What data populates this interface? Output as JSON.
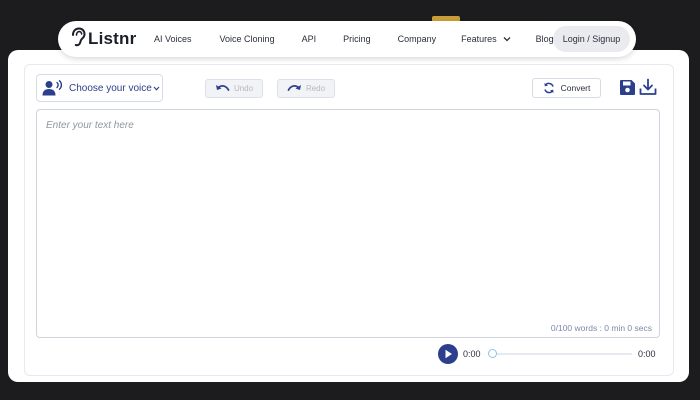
{
  "colors": {
    "accent": "#2b3f8c",
    "page_bg": "#1c1c1e",
    "card_bg": "#ffffff",
    "muted_text": "#8f96a3"
  },
  "nav": {
    "logo_text": "Listnr",
    "logo_icon": "ear-icon",
    "items": [
      {
        "label": "AI Voices"
      },
      {
        "label": "Voice Cloning"
      },
      {
        "label": "API"
      },
      {
        "label": "Pricing"
      },
      {
        "label": "Company"
      },
      {
        "label": "Features",
        "icon": "chevron-down-icon"
      },
      {
        "label": "Blog"
      }
    ],
    "login_label": "Login / Signup"
  },
  "toolbar": {
    "voice_label": "Choose your voice",
    "voice_icon": "speaking-person-icon",
    "undo_label": "Undo",
    "redo_label": "Redo",
    "convert_label": "Convert",
    "save_icon": "save-icon",
    "download_icon": "download-icon"
  },
  "editor": {
    "placeholder": "Enter your text here",
    "word_count": "0/100 words : 0 min 0 secs"
  },
  "player": {
    "current_time": "0:00",
    "end_time": "0:00",
    "progress": 0
  }
}
